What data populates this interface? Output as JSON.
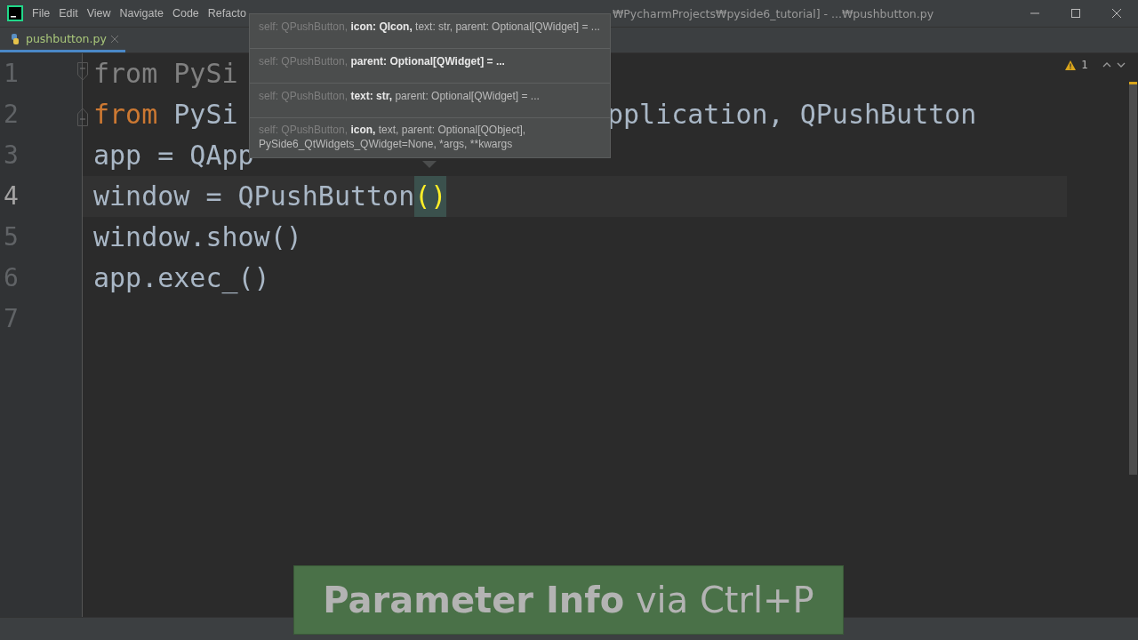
{
  "window": {
    "title": "₩PycharmProjects₩pyside6_tutorial] - ...₩pushbutton.py"
  },
  "menu": [
    "File",
    "Edit",
    "View",
    "Navigate",
    "Code",
    "Refacto"
  ],
  "tabs": [
    {
      "label": "pushbutton.py",
      "selected": true
    }
  ],
  "editor": {
    "warnings": "1",
    "lines": [
      {
        "number": "1",
        "current": false,
        "segments": [
          {
            "text": "from PySi",
            "kind": "unused"
          }
        ]
      },
      {
        "number": "2",
        "current": false,
        "segments": [
          {
            "text": "from",
            "kind": "keyword"
          },
          {
            "text": " PySi",
            "kind": "plain"
          }
        ],
        "segments_after_popup": [
          {
            "text": "pplication, QPushButton",
            "kind": "plain"
          }
        ]
      },
      {
        "number": "3",
        "current": false,
        "segments": [
          {
            "text": "app = QApp",
            "kind": "plain"
          }
        ]
      },
      {
        "number": "4",
        "current": true,
        "segments": [
          {
            "text": "window = QPushButton",
            "kind": "plain"
          },
          {
            "text": "()",
            "kind": "matched"
          }
        ]
      },
      {
        "number": "5",
        "current": false,
        "segments": [
          {
            "text": "window.show()",
            "kind": "plain"
          }
        ]
      },
      {
        "number": "6",
        "current": false,
        "segments": [
          {
            "text": "app.exec_()",
            "kind": "plain"
          }
        ]
      },
      {
        "number": "7",
        "current": false
      }
    ]
  },
  "parameter_info": [
    {
      "prefix": "self: QPushButton,",
      "current": "icon: QIcon,",
      "rest": "text: str, parent: Optional[QWidget] = ..."
    },
    {
      "prefix": "self: QPushButton,",
      "current": "parent: Optional[QWidget] = ..."
    },
    {
      "prefix": "self: QPushButton,",
      "current": "text: str,",
      "rest": "parent: Optional[QWidget] = ..."
    },
    {
      "prefix": "self: QPushButton,",
      "current": "icon,",
      "rest": "text, parent: Optional[QObject], PySide6_QtWidgets_QWidget=None, *args, **kwargs"
    }
  ],
  "caption": "**Parameter Info** via Ctrl+P"
}
